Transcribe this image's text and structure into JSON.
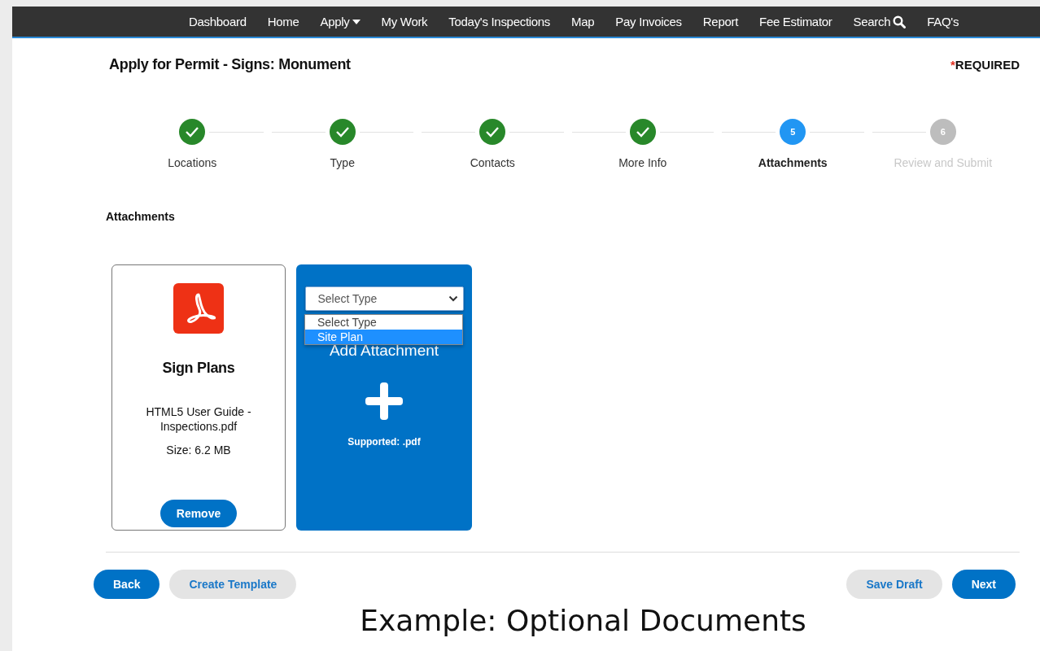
{
  "nav": {
    "items": [
      {
        "label": "Dashboard",
        "kind": "link"
      },
      {
        "label": "Home",
        "kind": "link"
      },
      {
        "label": "Apply",
        "kind": "dropdown"
      },
      {
        "label": "My Work",
        "kind": "link"
      },
      {
        "label": "Today's Inspections",
        "kind": "link"
      },
      {
        "label": "Map",
        "kind": "link"
      },
      {
        "label": "Pay Invoices",
        "kind": "link"
      },
      {
        "label": "Report",
        "kind": "link"
      },
      {
        "label": "Fee Estimator",
        "kind": "link"
      },
      {
        "label": "Search",
        "kind": "search"
      },
      {
        "label": "FAQ's",
        "kind": "link"
      }
    ]
  },
  "page": {
    "title": "Apply for Permit - Signs: Monument",
    "required_mark": "*",
    "required_label": "REQUIRED"
  },
  "steps": [
    {
      "label": "Locations",
      "completed": true,
      "selected": false
    },
    {
      "label": "Type",
      "completed": true,
      "selected": false
    },
    {
      "label": "Contacts",
      "completed": true,
      "selected": false
    },
    {
      "label": "More Info",
      "completed": true,
      "selected": false
    },
    {
      "label": "Attachments",
      "number": "5",
      "completed": false,
      "selected": true
    },
    {
      "label": "Review and Submit",
      "number": "6",
      "completed": false,
      "selected": false
    }
  ],
  "section_title": "Attachments",
  "attachments": [
    {
      "category": "Sign Plans",
      "file_name": "HTML5 User Guide - Inspections.pdf",
      "size": "Size: 6.2 MB",
      "remove_button": "Remove"
    }
  ],
  "add_card": {
    "title": "Add Attachment",
    "supported": "Supported: .pdf",
    "type_select": {
      "value": "Select Type",
      "expanded": true,
      "options": [
        {
          "label": "Select Type",
          "selected": true,
          "highlighted": false
        },
        {
          "label": "Site Plan",
          "selected": false,
          "highlighted": true
        }
      ]
    }
  },
  "buttons_left": [
    {
      "label": "Back",
      "kind": "primary"
    },
    {
      "label": "Create Template",
      "kind": "secondary"
    }
  ],
  "buttons_right": [
    {
      "label": "Save Draft",
      "kind": "secondary"
    },
    {
      "label": "Next",
      "kind": "primary"
    }
  ],
  "caption": "Example: Optional Documents"
}
